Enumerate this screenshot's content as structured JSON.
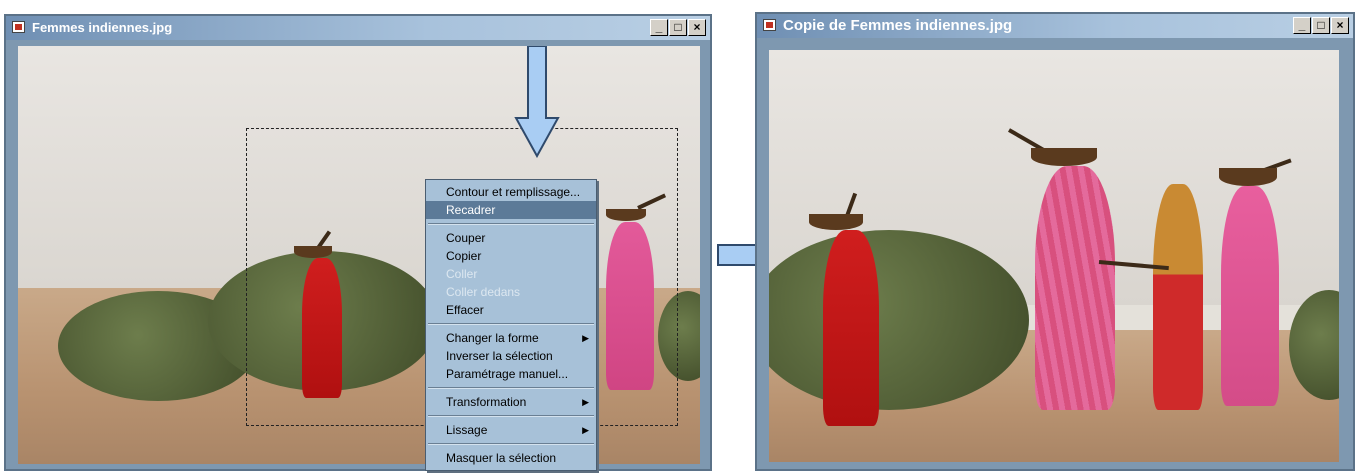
{
  "left_window": {
    "title": "Femmes indiennes.jpg",
    "buttons": [
      "_",
      "□",
      "×"
    ]
  },
  "right_window": {
    "title": "Copie de Femmes indiennes.jpg",
    "buttons": [
      "_",
      "□",
      "×"
    ]
  },
  "context_menu": {
    "items": [
      {
        "label": "Contour et remplissage...",
        "state": "normal"
      },
      {
        "label": "Recadrer",
        "state": "highlighted"
      },
      {
        "label": "Couper",
        "state": "normal"
      },
      {
        "label": "Copier",
        "state": "normal"
      },
      {
        "label": "Coller",
        "state": "disabled"
      },
      {
        "label": "Coller dedans",
        "state": "disabled"
      },
      {
        "label": "Effacer",
        "state": "normal"
      },
      {
        "label": "Changer la forme",
        "state": "submenu"
      },
      {
        "label": "Inverser la sélection",
        "state": "normal"
      },
      {
        "label": "Paramétrage manuel...",
        "state": "normal"
      },
      {
        "label": "Transformation",
        "state": "submenu"
      },
      {
        "label": "Lissage",
        "state": "submenu"
      },
      {
        "label": "Masquer la sélection",
        "state": "normal"
      }
    ],
    "submenu_glyph": "▶"
  },
  "colors": {
    "arrow_fill": "#a9cdf3",
    "arrow_stroke": "#2f4a6c",
    "menu_bg": "#a7c1d8",
    "menu_highlight": "#5c7a98"
  }
}
